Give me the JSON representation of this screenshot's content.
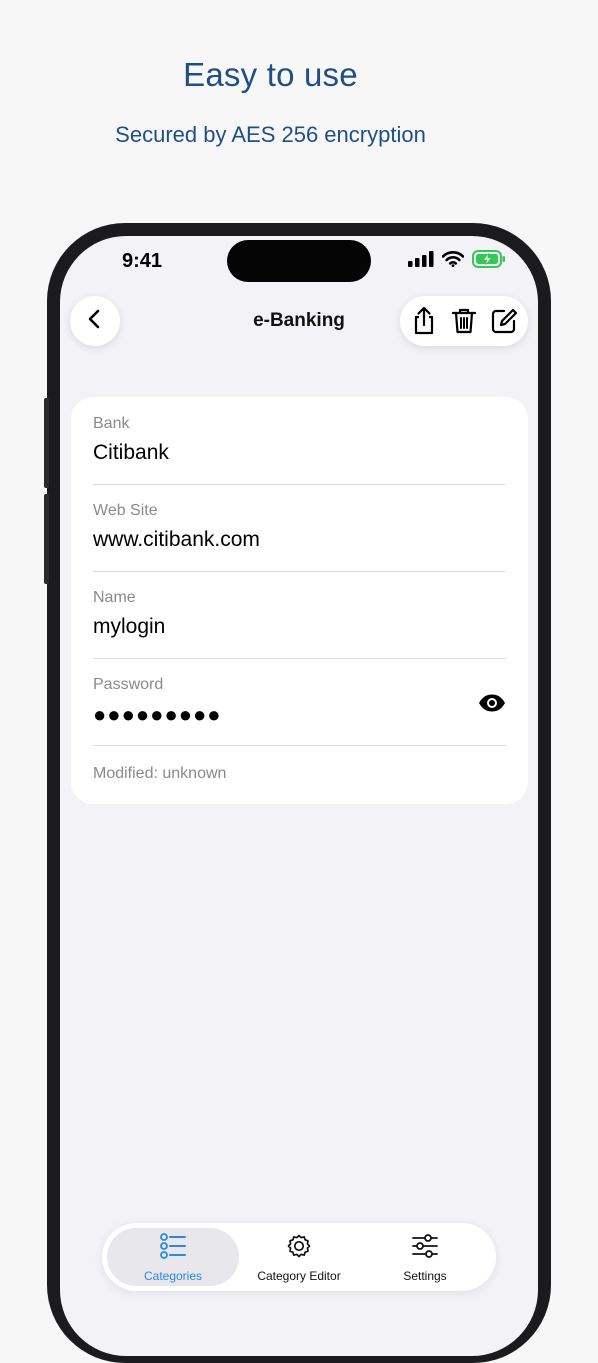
{
  "promo": {
    "headline": "Easy to use",
    "subline": "Secured by AES 256 encryption"
  },
  "status_bar": {
    "time": "9:41",
    "icons": [
      "cellular-signal-icon",
      "wifi-icon",
      "battery-charging-icon"
    ]
  },
  "nav": {
    "title": "e-Banking",
    "back_icon": "chevron-left-icon",
    "actions": [
      "share-icon",
      "trash-icon",
      "edit-icon"
    ]
  },
  "record": {
    "fields": [
      {
        "label": "Bank",
        "value": "Citibank"
      },
      {
        "label": "Web Site",
        "value": "www.citibank.com"
      },
      {
        "label": "Name",
        "value": "mylogin"
      },
      {
        "label": "Password",
        "value": "●●●●●●●●●"
      }
    ],
    "modified": "Modified: unknown"
  },
  "tabbar": {
    "items": [
      {
        "label": "Categories",
        "icon": "list-icon",
        "active": true
      },
      {
        "label": "Category Editor",
        "icon": "gear-icon",
        "active": false
      },
      {
        "label": "Settings",
        "icon": "sliders-icon",
        "active": false
      }
    ]
  },
  "colors": {
    "accent": "#2b88e0",
    "headline": "#1f4f86",
    "battery": "#34c759"
  }
}
